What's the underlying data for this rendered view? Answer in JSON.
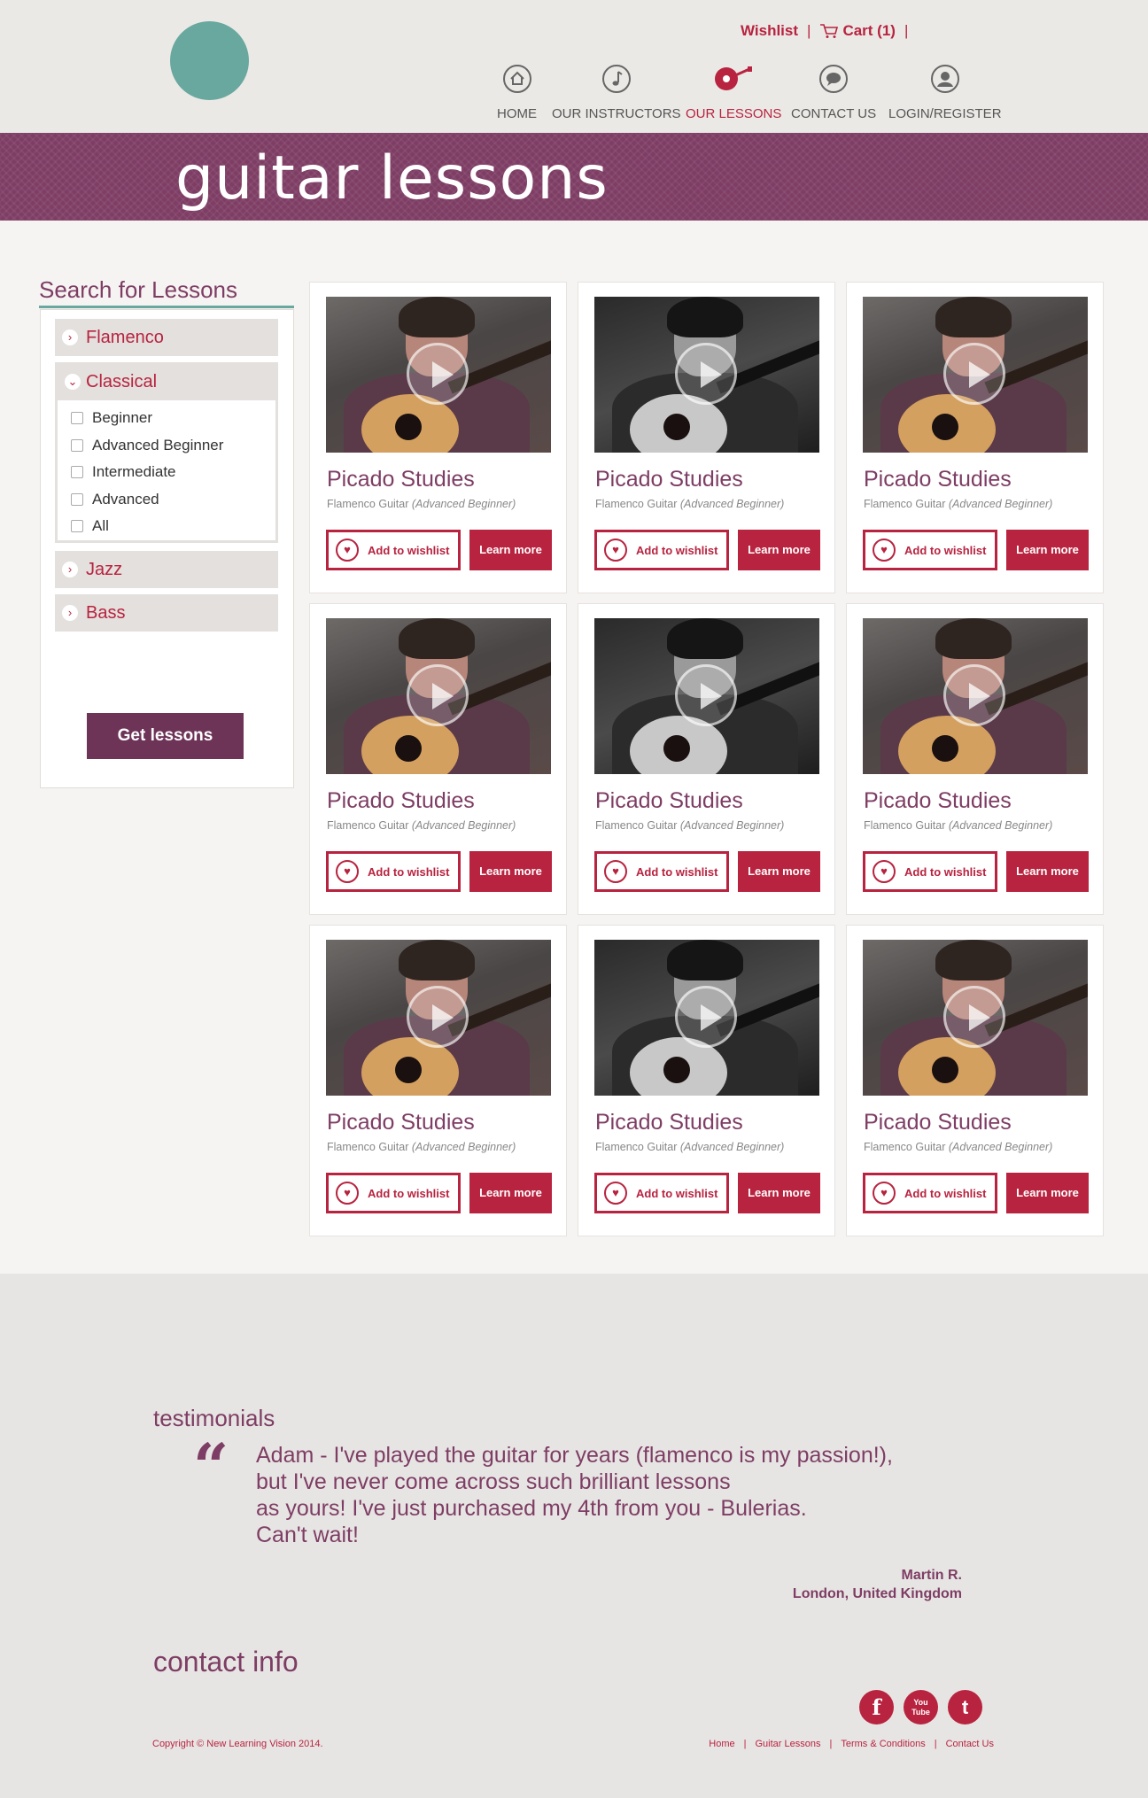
{
  "header": {
    "wishlist_label": "Wishlist",
    "cart_label": "Cart (1)",
    "nav": [
      {
        "label": "HOME",
        "icon": "home-icon"
      },
      {
        "label": "OUR INSTRUCTORS",
        "icon": "music-note-icon"
      },
      {
        "label": "OUR LESSONS",
        "icon": "guitar-icon",
        "active": true
      },
      {
        "label": "CONTACT US",
        "icon": "chat-bubble-icon"
      },
      {
        "label": "LOGIN/REGISTER",
        "icon": "user-icon"
      }
    ]
  },
  "banner": {
    "title": "guitar lessons"
  },
  "sidebar": {
    "title": "Search for Lessons",
    "categories": [
      {
        "label": "Flamenco",
        "expanded": false
      },
      {
        "label": "Classical",
        "expanded": true
      },
      {
        "label": "Jazz",
        "expanded": false
      },
      {
        "label": "Bass",
        "expanded": false
      }
    ],
    "levels": [
      "Beginner",
      "Advanced Beginner",
      "Intermediate",
      "Advanced",
      "All"
    ],
    "button_label": "Get lessons"
  },
  "lessons": [
    {
      "title": "Picado Studies",
      "subtitle": "Flamenco Guitar",
      "level": "(Advanced Beginner)",
      "wishlist_label": "Add to wishlist",
      "learn_label": "Learn more",
      "image": "color"
    },
    {
      "title": "Picado Studies",
      "subtitle": "Flamenco Guitar",
      "level": "(Advanced Beginner)",
      "wishlist_label": "Add to wishlist",
      "learn_label": "Learn more",
      "image": "bw"
    },
    {
      "title": "Picado Studies",
      "subtitle": "Flamenco Guitar",
      "level": "(Advanced Beginner)",
      "wishlist_label": "Add to wishlist",
      "learn_label": "Learn more",
      "image": "color"
    },
    {
      "title": "Picado Studies",
      "subtitle": "Flamenco Guitar",
      "level": "(Advanced Beginner)",
      "wishlist_label": "Add to wishlist",
      "learn_label": "Learn more",
      "image": "color"
    },
    {
      "title": "Picado Studies",
      "subtitle": "Flamenco Guitar",
      "level": "(Advanced Beginner)",
      "wishlist_label": "Add to wishlist",
      "learn_label": "Learn more",
      "image": "bw"
    },
    {
      "title": "Picado Studies",
      "subtitle": "Flamenco Guitar",
      "level": "(Advanced Beginner)",
      "wishlist_label": "Add to wishlist",
      "learn_label": "Learn more",
      "image": "color"
    },
    {
      "title": "Picado Studies",
      "subtitle": "Flamenco Guitar",
      "level": "(Advanced Beginner)",
      "wishlist_label": "Add to wishlist",
      "learn_label": "Learn more",
      "image": "color"
    },
    {
      "title": "Picado Studies",
      "subtitle": "Flamenco Guitar",
      "level": "(Advanced Beginner)",
      "wishlist_label": "Add to wishlist",
      "learn_label": "Learn more",
      "image": "bw"
    },
    {
      "title": "Picado Studies",
      "subtitle": "Flamenco Guitar",
      "level": "(Advanced Beginner)",
      "wishlist_label": "Add to wishlist",
      "learn_label": "Learn more",
      "image": "color"
    }
  ],
  "testimonials": {
    "title": "testimonials",
    "quote_lines": [
      "Adam - I've played the guitar for years (flamenco is my passion!),",
      "but I've never come across such brilliant lessons",
      "as yours! I've just purchased my 4th from you - Bulerias.",
      "Can't wait!"
    ],
    "author_name": "Martin R.",
    "author_location": "London, United Kingdom"
  },
  "footer": {
    "contact_title": "contact info",
    "social": [
      {
        "label": "f",
        "icon": "facebook-icon"
      },
      {
        "label": "You Tube",
        "icon": "youtube-icon"
      },
      {
        "label": "t",
        "icon": "twitter-icon"
      }
    ],
    "copyright": "Copyright © New Learning Vision 2014.",
    "links": [
      "Home",
      "Guitar Lessons",
      "Terms & Conditions",
      "Contact Us"
    ]
  },
  "colors": {
    "brand_purple": "#7e3d64",
    "brand_red": "#b8233f",
    "teal": "#68a89e"
  }
}
